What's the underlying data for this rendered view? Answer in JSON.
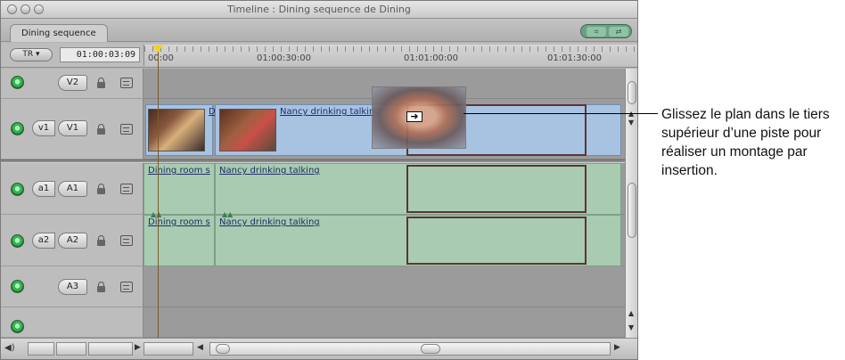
{
  "window": {
    "title": "Timeline : Dining sequence de Dining"
  },
  "tabs": {
    "sequence_tab": "Dining sequence"
  },
  "ruler": {
    "rt_menu": "TR ▾",
    "timecode": "01:00:03:09",
    "labels": [
      "00:00",
      "01:00:30:00",
      "01:01:00:00",
      "01:01:30:00"
    ]
  },
  "tracks": {
    "v2": {
      "dest": "V2"
    },
    "v1": {
      "source": "v1",
      "dest": "V1"
    },
    "a1": {
      "source": "a1",
      "dest": "A1"
    },
    "a2": {
      "source": "a2",
      "dest": "A2"
    },
    "a3": {
      "dest": "A3"
    }
  },
  "clips": {
    "v1_clip1_label": "D",
    "v1_clip2_label": "Nancy drinking talking",
    "a1_clip1_label": "Dining room s",
    "a1_clip2_label": "Nancy drinking talking",
    "a2_clip1_label": "Dining room s",
    "a2_clip2_label": "Nancy drinking talking"
  },
  "callout": {
    "text": "Glissez le plan dans le tiers supérieur d’une piste pour réaliser un montage par insertion."
  },
  "colors": {
    "video_clip": "#a8c2e2",
    "audio_clip": "#a9cbb1",
    "drop_outline": "#5b3437",
    "track_visibility": "#37b050"
  }
}
